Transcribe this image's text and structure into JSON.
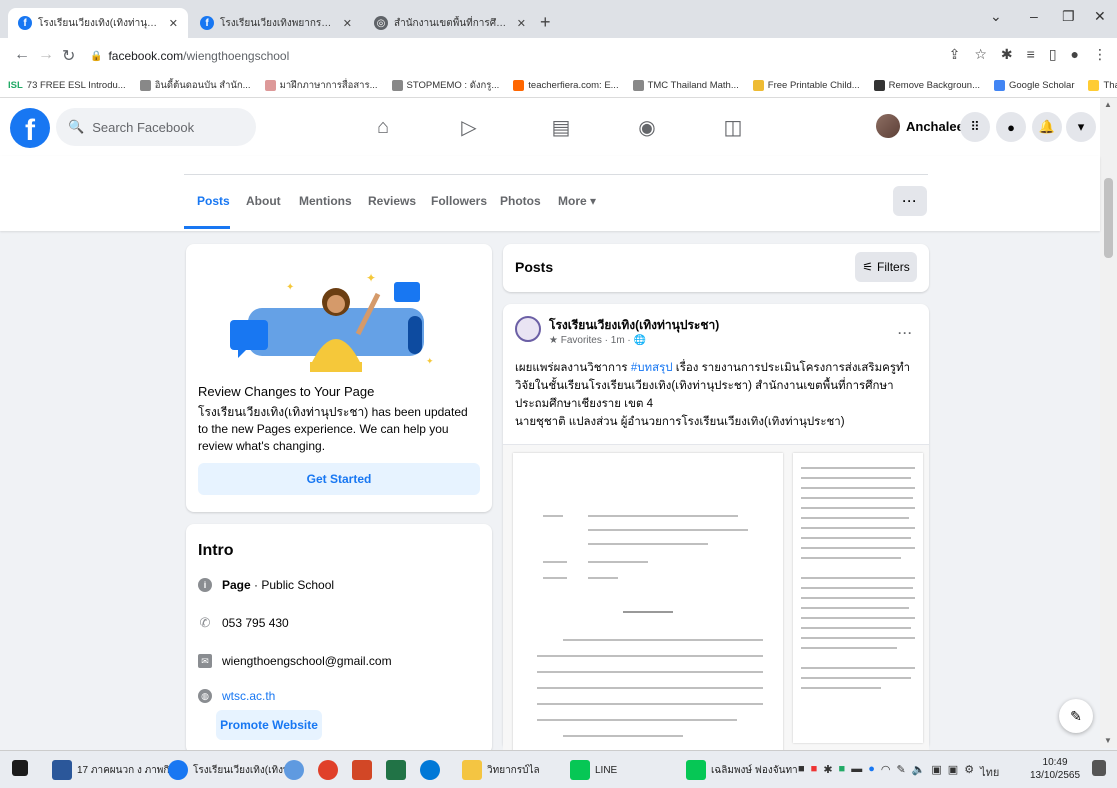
{
  "browser": {
    "tabs": [
      {
        "title": "โรงเรียนเวียงเทิง(เทิงท่านุประชา) | Face",
        "close": "✕",
        "active": true
      },
      {
        "title": "โรงเรียนเวียงเทิงพยากรณ์ | Facebook",
        "close": "✕",
        "active": false
      },
      {
        "title": "สำนักงานเขตพื้นที่การศึกษาประถมศึ",
        "close": "✕",
        "active": false
      }
    ],
    "new_tab": "+",
    "url_host": "facebook.com",
    "url_path": "/wiengthoengschool",
    "bookmarks": [
      "73 FREE ESL Introdu...",
      "อินดี้ต้นดอนบัน สำนัก...",
      "มาฝึกภาษาการสื่อสาร...",
      "STOPMEMO : ดังกรู...",
      "teacherfiera.com: E...",
      "TMC Thailand Math...",
      "Free Printable Child...",
      "Remove Backgroun...",
      "Google Scholar",
      "ThaiDocs"
    ],
    "bookmark_prefix": "ISL"
  },
  "fb": {
    "search_placeholder": "Search Facebook",
    "profile_name": "Anchalee",
    "page_tabs": [
      "Posts",
      "About",
      "Mentions",
      "Reviews",
      "Followers",
      "Photos",
      "More ▾"
    ],
    "more_dots": "···"
  },
  "review": {
    "title": "Review Changes to Your Page",
    "text": "โรงเรียนเวียงเทิง(เทิงท่านุประชา) has been updated to the new Pages experience. We can help you review what's changing.",
    "button": "Get Started"
  },
  "intro": {
    "title": "Intro",
    "category": "Page",
    "category_suffix": " · Public School",
    "phone": "053 795 430",
    "email": "wiengthoengschool@gmail.com",
    "website": "wtsc.ac.th",
    "promote": "Promote Website"
  },
  "posts": {
    "title": "Posts",
    "filters": "Filters",
    "author": "โรงเรียนเวียงเทิง(เทิงท่านุประชา)",
    "meta": "★ Favorites · 1m · 🌐",
    "dots": "···",
    "text_pre": "เผยแพร่ผลงานวิชาการ ",
    "hashtag": "#บทสรุป",
    "text_post": " เรื่อง รายงานการประเมินโครงการส่งเสริมครูทำวิจัยในชั้นเรียนโรงเรียนเวียงเทิง(เทิงท่านุประชา) สำนักงานเขตพื้นที่การศึกษาประถมศึกษาเชียงราย เขต 4",
    "byline": "นายชุชาติ แปลงส่วน ผู้อำนวยการโรงเรียนเวียงเทิง(เทิงท่านุประชา)"
  },
  "taskbar": {
    "items": [
      "17 ภาคผนวก ง ภาพกิ...",
      "โรงเรียนเวียงเทิง(เทิงท...",
      "วิทยากรบ์ไล",
      "LINE",
      "เฉลิมพงษ์ ฟองจันทา"
    ],
    "time": "10:49",
    "date": "13/10/2565",
    "lang": "ไทย"
  },
  "colors": {
    "fb_blue": "#1877f2",
    "page_bg": "#f0f2f5"
  }
}
